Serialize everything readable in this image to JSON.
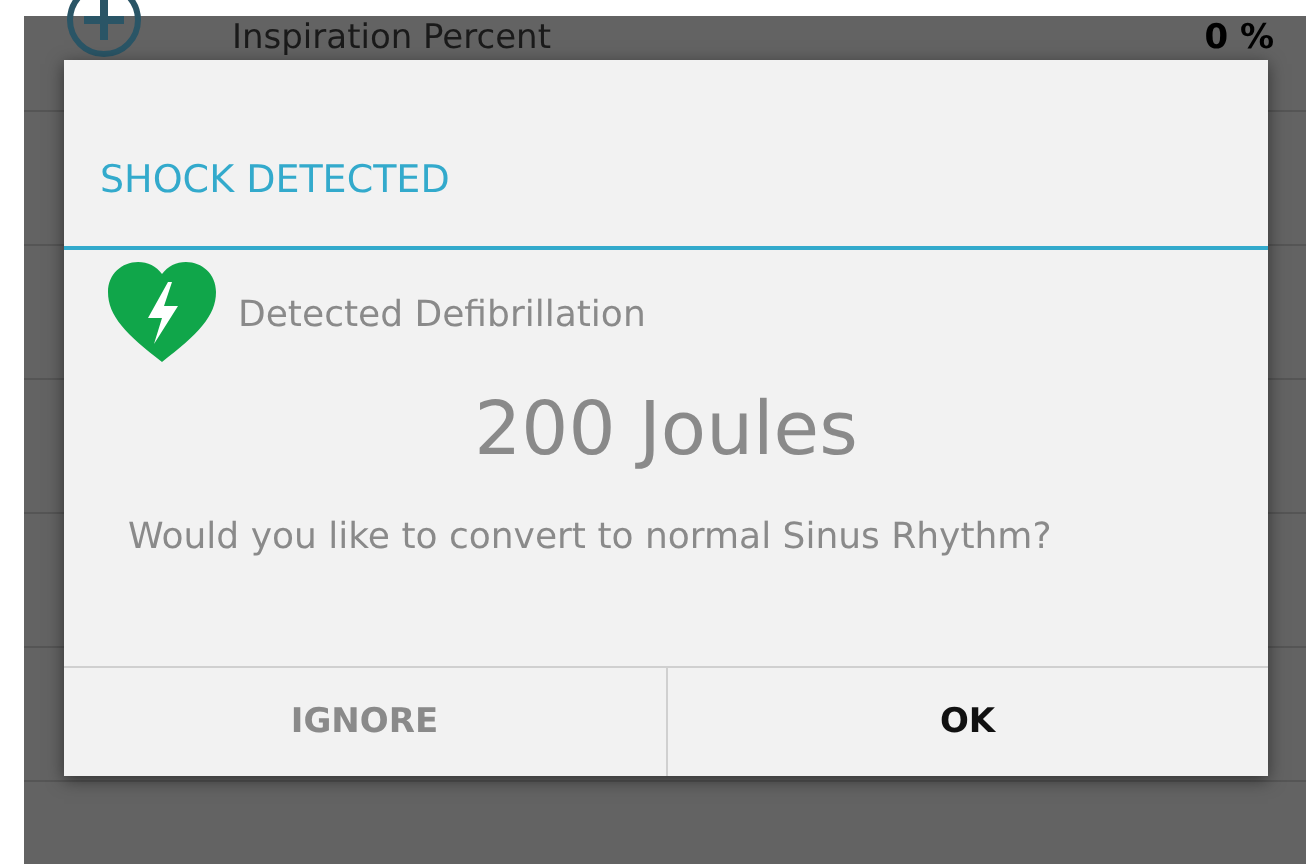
{
  "background_list": {
    "rows": [
      {
        "label": "Inspiration Percent",
        "value": "0 %"
      }
    ]
  },
  "dialog": {
    "title": "SHOCK DETECTED",
    "detail": "Detected Defibrillation",
    "energy": "200 Joules",
    "question": "Would you like to convert to normal Sinus Rhythm?",
    "buttons": [
      {
        "label": "IGNORE",
        "kind": "secondary"
      },
      {
        "label": "OK",
        "kind": "primary"
      }
    ]
  }
}
